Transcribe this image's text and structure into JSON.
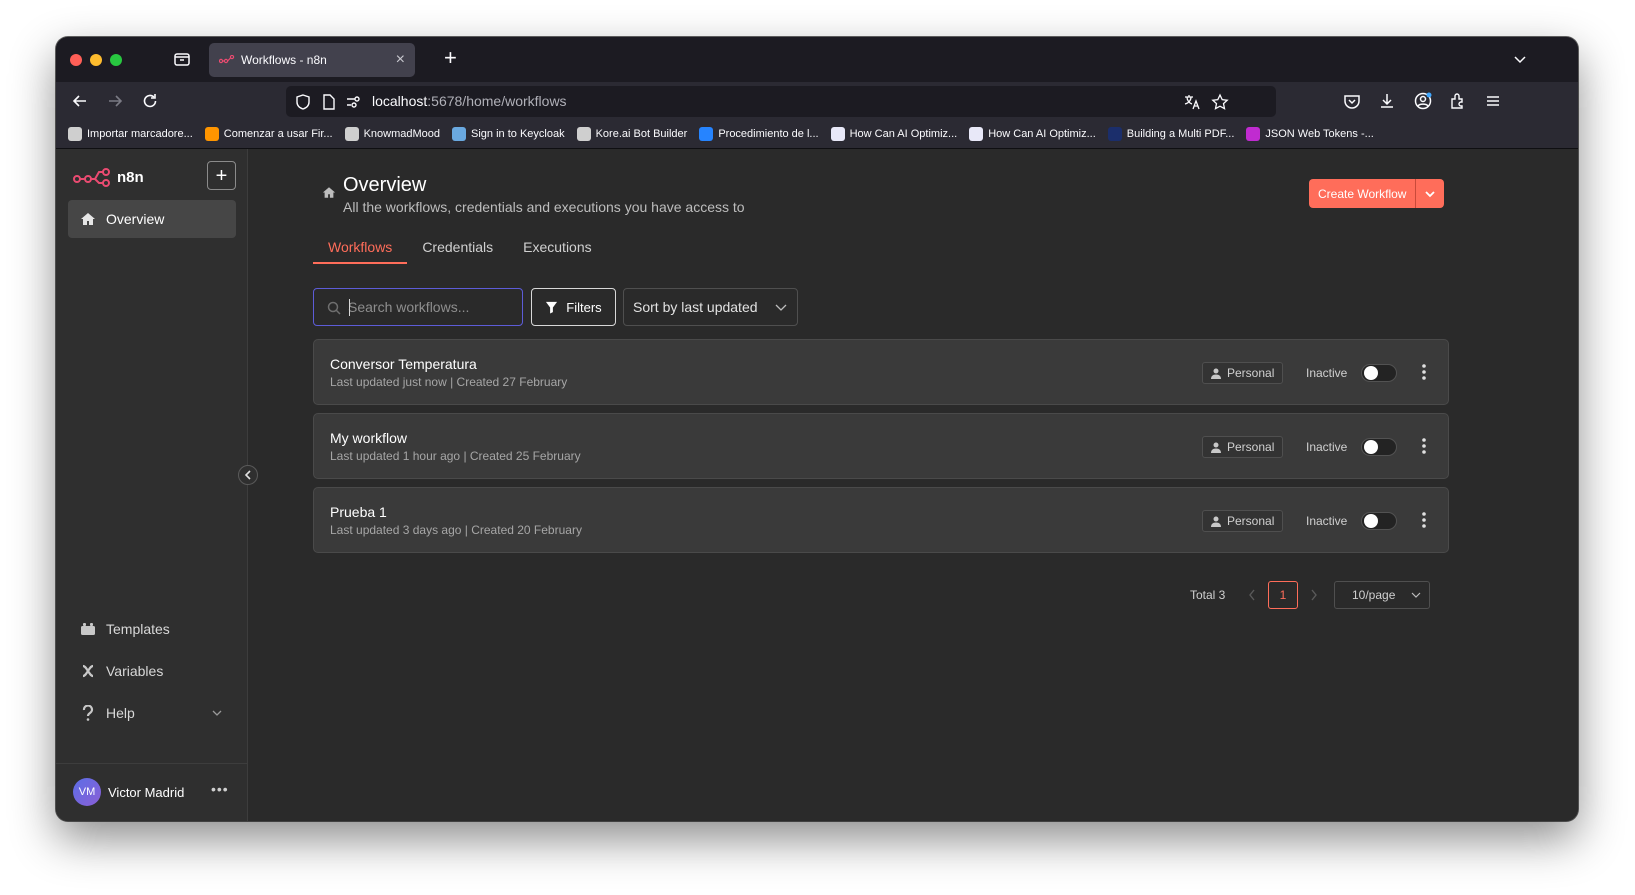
{
  "browser": {
    "tab_title": "Workflows - n8n",
    "url_host": "localhost",
    "url_path": ":5678/home/workflows",
    "bookmarks": [
      {
        "label": "Importar marcadore...",
        "color": "#cfcfcf"
      },
      {
        "label": "Comenzar a usar Fir...",
        "color": "#ff9500"
      },
      {
        "label": "KnowmadMood",
        "color": "#cfcfcf"
      },
      {
        "label": "Sign in to Keycloak",
        "color": "#6aa9e0"
      },
      {
        "label": "Kore.ai Bot Builder",
        "color": "#cfcfcf"
      },
      {
        "label": "Procedimiento de l...",
        "color": "#2684ff"
      },
      {
        "label": "How Can AI Optimiz...",
        "color": "#e8e8f8"
      },
      {
        "label": "How Can AI Optimiz...",
        "color": "#e8e8f8"
      },
      {
        "label": "Building a Multi PDF...",
        "color": "#1b2e6b"
      },
      {
        "label": "JSON Web Tokens -...",
        "color": "#c02bd0"
      }
    ]
  },
  "sidebar": {
    "logo": "n8n",
    "add_label": "+",
    "nav": [
      {
        "label": "Overview",
        "icon": "home-icon"
      }
    ],
    "bottom_nav": [
      {
        "label": "Templates",
        "icon": "templates-icon"
      },
      {
        "label": "Variables",
        "icon": "variables-icon"
      },
      {
        "label": "Help",
        "icon": "help-icon"
      }
    ],
    "user": {
      "initials": "VM",
      "name": "Victor Madrid"
    }
  },
  "main": {
    "title": "Overview",
    "subtitle": "All the workflows, credentials and executions you have access to",
    "create_button": "Create Workflow",
    "tabs": [
      "Workflows",
      "Credentials",
      "Executions"
    ],
    "search_placeholder": "Search workflows...",
    "filters_label": "Filters",
    "sort_label": "Sort by last updated",
    "workflows": [
      {
        "name": "Conversor Temperatura",
        "meta": "Last updated just now | Created 27 February",
        "badge": "Personal",
        "status": "Inactive"
      },
      {
        "name": "My workflow",
        "meta": "Last updated 1 hour ago | Created 25 February",
        "badge": "Personal",
        "status": "Inactive"
      },
      {
        "name": "Prueba 1",
        "meta": "Last updated 3 days ago | Created 20 February",
        "badge": "Personal",
        "status": "Inactive"
      }
    ],
    "pagination": {
      "total": "Total 3",
      "page": "1",
      "page_size": "10/page"
    }
  },
  "colors": {
    "accent": "#ff6d5a",
    "focus": "#5d5cd8"
  }
}
